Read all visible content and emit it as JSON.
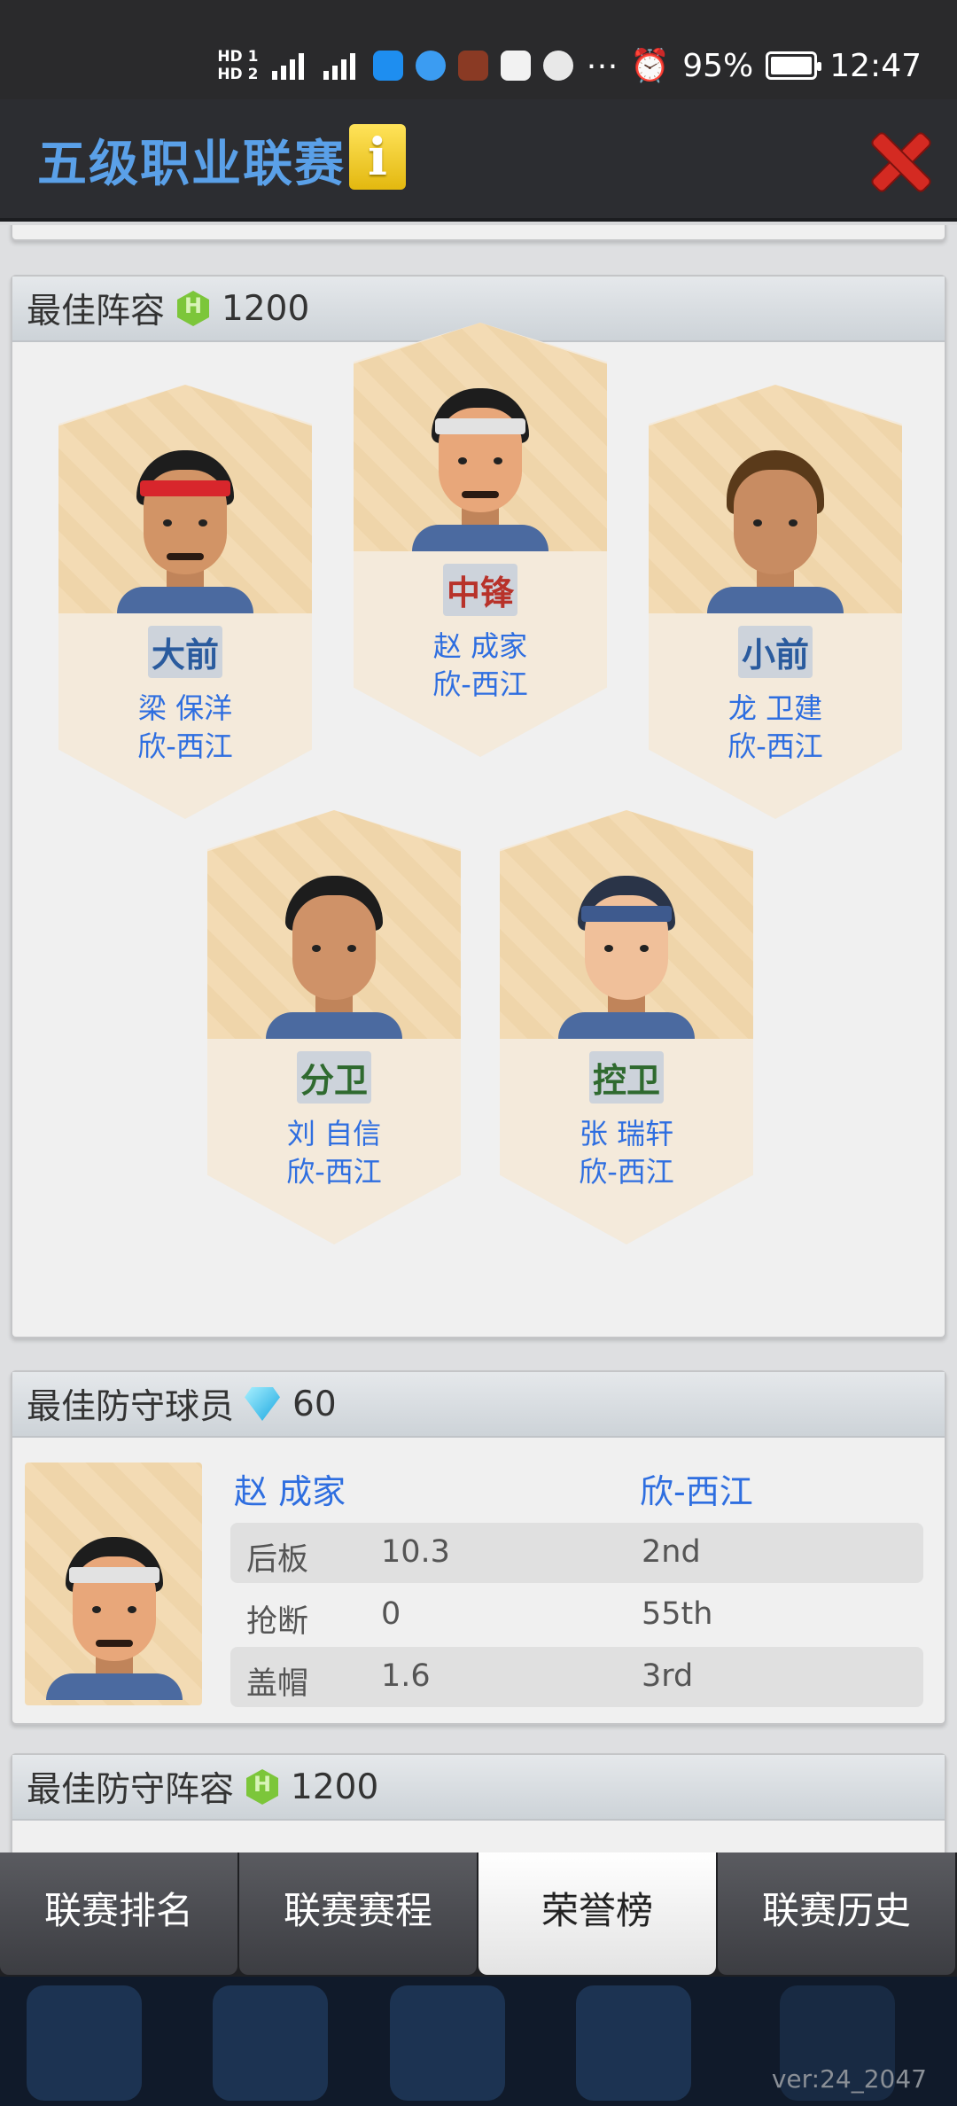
{
  "status_bar": {
    "hd1": "HD 1",
    "hd2": "HD 2",
    "battery": "95%",
    "time": "12:47"
  },
  "header": {
    "title": "五级职业联赛",
    "info_icon": "i"
  },
  "best_lineup": {
    "title": "最佳阵容",
    "reward_value": "1200",
    "players": [
      {
        "position": "大前",
        "name": "梁 保洋",
        "team": "欣-西江",
        "position_color": "#2a5b9e"
      },
      {
        "position": "中锋",
        "name": "赵 成家",
        "team": "欣-西江",
        "position_color": "#b8322a"
      },
      {
        "position": "小前",
        "name": "龙 卫建",
        "team": "欣-西江",
        "position_color": "#2a5b9e"
      },
      {
        "position": "分卫",
        "name": "刘 自信",
        "team": "欣-西江",
        "position_color": "#2f6a2f"
      },
      {
        "position": "控卫",
        "name": "张 瑞轩",
        "team": "欣-西江",
        "position_color": "#2f6a2f"
      }
    ]
  },
  "best_defender": {
    "title": "最佳防守球员",
    "reward_value": "60",
    "name": "赵 成家",
    "team": "欣-西江",
    "stats": [
      {
        "label": "后板",
        "value": "10.3",
        "rank": "2nd"
      },
      {
        "label": "抢断",
        "value": "0",
        "rank": "55th"
      },
      {
        "label": "盖帽",
        "value": "1.6",
        "rank": "3rd"
      }
    ]
  },
  "best_defensive_lineup": {
    "title": "最佳防守阵容",
    "reward_value": "1200"
  },
  "tabs": [
    {
      "label": "联赛排名",
      "active": false
    },
    {
      "label": "联赛赛程",
      "active": false
    },
    {
      "label": "荣誉榜",
      "active": true
    },
    {
      "label": "联赛历史",
      "active": false
    }
  ],
  "version": "ver:24_2047",
  "colors": {
    "link_blue": "#2e6ee0",
    "title_blue": "#5aa0e8",
    "close_red": "#d42a22"
  }
}
